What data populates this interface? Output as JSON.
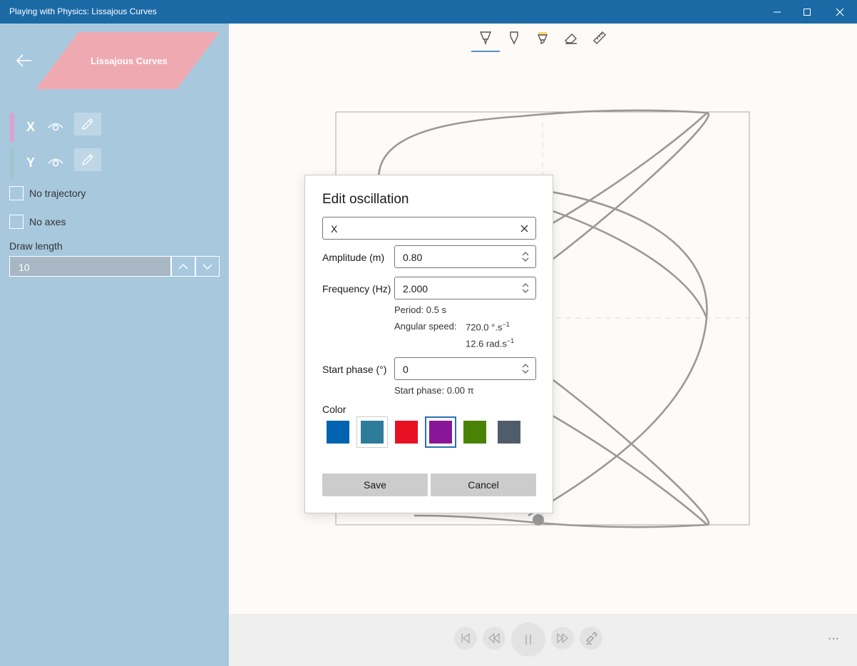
{
  "window": {
    "title": "Playing with Physics: Lissajous Curves"
  },
  "sidebar": {
    "banner_title": "Lissajous Curves",
    "oscillations": [
      {
        "label": "X",
        "color": "#d9a3cf"
      },
      {
        "label": "Y",
        "color": "#9fc6c9"
      }
    ],
    "no_trajectory_label": "No trajectory",
    "no_axes_label": "No axes",
    "draw_length_label": "Draw length",
    "draw_length_value": "10"
  },
  "dialog": {
    "title": "Edit oscillation",
    "name_value": "X",
    "amplitude_label": "Amplitude (m)",
    "amplitude_value": "0.80",
    "frequency_label": "Frequency (Hz)",
    "frequency_value": "2.000",
    "period_text": "Period: 0.5 s",
    "angular_speed_label": "Angular speed:",
    "angular_speed_deg": "720.0 °.s",
    "angular_speed_rad": "12.6 rad.s",
    "exponent": "−1",
    "start_phase_label": "Start phase (°)",
    "start_phase_value": "0",
    "start_phase_text": "Start phase: 0.00 π",
    "color_label": "Color",
    "colors": [
      "#0063b1",
      "#2d7d9a",
      "#e81123",
      "#881798",
      "#498205",
      "#515c6b"
    ],
    "selected_color": "#881798",
    "save_label": "Save",
    "cancel_label": "Cancel"
  },
  "bottombar": {
    "more_label": "···"
  },
  "icons": [
    "back-arrow-icon",
    "eye-icon",
    "pencil-icon",
    "ballpoint-pen-icon",
    "pencil-tool-icon",
    "highlighter-icon",
    "eraser-icon",
    "ruler-icon",
    "skip-back-icon",
    "rewind-icon",
    "pause-icon",
    "fast-forward-icon",
    "touch-writing-icon",
    "close-icon",
    "spin-icon",
    "minimize-icon",
    "maximize-icon"
  ]
}
